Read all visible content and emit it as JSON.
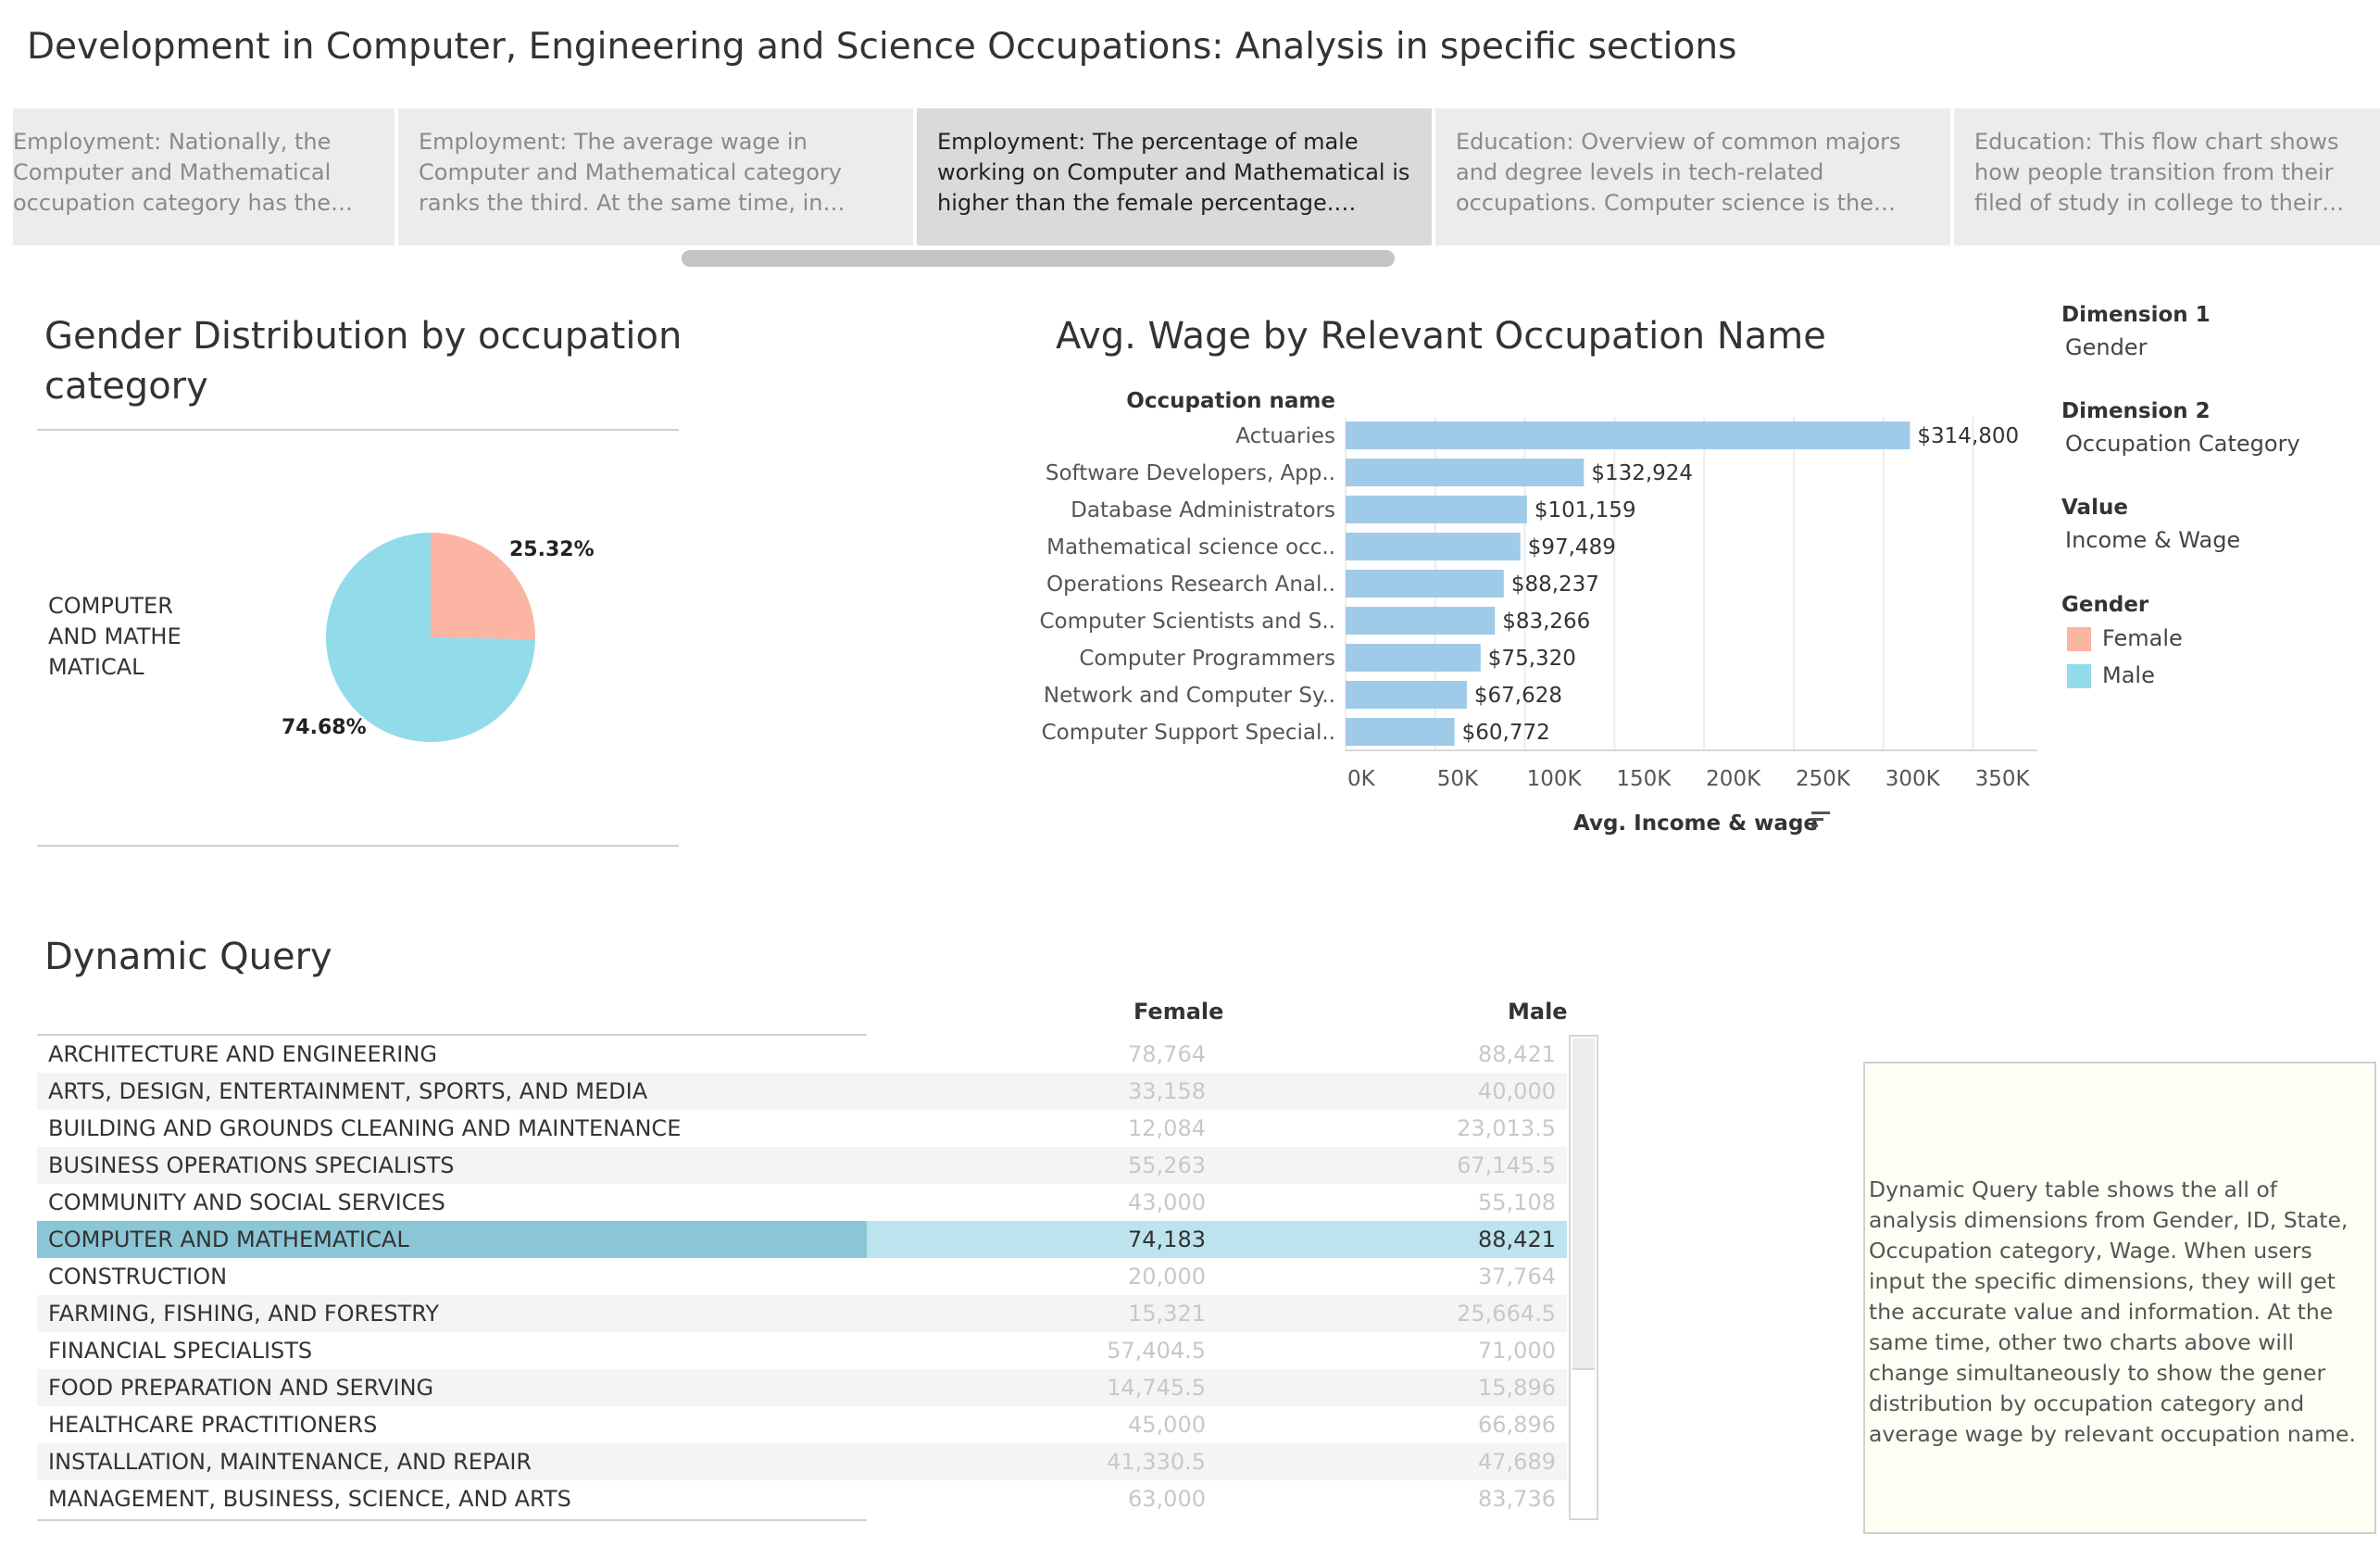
{
  "page": {
    "title": "Development in Computer, Engineering and Science Occupations: Analysis in specific sections"
  },
  "story": {
    "points": [
      {
        "text": "Employment: Nationally, the Computer and Mathematical occupation category has the high.."
      },
      {
        "text": "Employment:  The average wage in Computer and Mathematical category ranks the third. At the same time, in Computer and Mathema.."
      },
      {
        "text": "Employment: The percentage of male working on Computer and Mathematical is higher than the female percentage. However, the media.."
      },
      {
        "text": "Education: Overview of common majors and degree levels in tech-related occupations. Computer science is the most popular major .."
      },
      {
        "text": "Education: This flow chart shows how people transition from their filed of study in college to their eventual oc.."
      }
    ],
    "active_index": 2
  },
  "pie": {
    "title": "Gender Distribution by occupation category",
    "category_label": "COMPUTER AND MATHE MATICAL",
    "female_pct_label": "25.32%",
    "male_pct_label": "74.68%"
  },
  "bar": {
    "title": "Avg. Wage by Relevant Occupation Name",
    "row_header": "Occupation name",
    "axis_label": "Avg. Income & wage",
    "sort_icon": "sort-descending-icon"
  },
  "chart_data": [
    {
      "type": "pie",
      "title": "Gender Distribution by occupation category",
      "categories": [
        "Female",
        "Male"
      ],
      "values": [
        25.32,
        74.68
      ],
      "colors": [
        "#fcb5a3",
        "#92dbea"
      ]
    },
    {
      "type": "bar",
      "orientation": "horizontal",
      "title": "Avg. Wage by Relevant Occupation Name",
      "ylabel": "Occupation name",
      "xlabel": "Avg. Income & wage",
      "categories": [
        "Actuaries",
        "Software Developers, App..",
        "Database Administrators",
        "Mathematical science occ..",
        "Operations Research Anal..",
        "Computer Scientists and S..",
        "Computer Programmers",
        "Network and Computer Sy..",
        "Computer Support Special.."
      ],
      "values": [
        314800,
        132924,
        101159,
        97489,
        88237,
        83266,
        75320,
        67628,
        60772
      ],
      "value_labels": [
        "$314,800",
        "$132,924",
        "$101,159",
        "$97,489",
        "$88,237",
        "$83,266",
        "$75,320",
        "$67,628",
        "$60,772"
      ],
      "xlim": [
        0,
        390000
      ],
      "xticks": [
        0,
        50000,
        100000,
        150000,
        200000,
        250000,
        300000,
        350000
      ],
      "xtick_labels": [
        "0K",
        "50K",
        "100K",
        "150K",
        "200K",
        "250K",
        "300K",
        "350K"
      ],
      "grid": true,
      "bar_color": "#9fcbe9"
    }
  ],
  "legend": {
    "dim1_label": "Dimension 1",
    "dim1_value": "Gender",
    "dim2_label": "Dimension 2",
    "dim2_value": "Occupation Category",
    "value_label": "Value",
    "value_value": "Income & Wage",
    "gender_label": "Gender",
    "female": "Female",
    "male": "Male",
    "female_color": "#fcb5a3",
    "male_color": "#92dbea"
  },
  "table": {
    "title": "Dynamic Query",
    "col_female": "Female",
    "col_male": "Male",
    "rows": [
      {
        "category": "ARCHITECTURE AND ENGINEERING",
        "female": "78,764",
        "male": "88,421"
      },
      {
        "category": "ARTS, DESIGN, ENTERTAINMENT, SPORTS, AND MEDIA",
        "female": "33,158",
        "male": "40,000"
      },
      {
        "category": "BUILDING AND GROUNDS CLEANING AND MAINTENANCE",
        "female": "12,084",
        "male": "23,013.5"
      },
      {
        "category": "BUSINESS OPERATIONS SPECIALISTS",
        "female": "55,263",
        "male": "67,145.5"
      },
      {
        "category": "COMMUNITY AND SOCIAL SERVICES",
        "female": "43,000",
        "male": "55,108"
      },
      {
        "category": "COMPUTER AND MATHEMATICAL",
        "female": "74,183",
        "male": "88,421"
      },
      {
        "category": "CONSTRUCTION",
        "female": "20,000",
        "male": "37,764"
      },
      {
        "category": "FARMING, FISHING, AND FORESTRY",
        "female": "15,321",
        "male": "25,664.5"
      },
      {
        "category": "FINANCIAL SPECIALISTS",
        "female": "57,404.5",
        "male": "71,000"
      },
      {
        "category": "FOOD PREPARATION AND SERVING",
        "female": "14,745.5",
        "male": "15,896"
      },
      {
        "category": "HEALTHCARE PRACTITIONERS",
        "female": "45,000",
        "male": "66,896"
      },
      {
        "category": "INSTALLATION, MAINTENANCE, AND REPAIR",
        "female": "41,330.5",
        "male": "47,689"
      },
      {
        "category": "MANAGEMENT, BUSINESS, SCIENCE, AND ARTS",
        "female": "63,000",
        "male": "83,736"
      }
    ],
    "selected_index": 5
  },
  "note": {
    "text": "Dynamic Query table shows the all of analysis dimensions from Gender, ID, State, Occupation category, Wage. When users input the specific dimensions, they will get the accurate value and information. At the same time, other two charts above will change simultaneously to show the gener distribution by occupation category and average wage by relevant occupation name."
  }
}
